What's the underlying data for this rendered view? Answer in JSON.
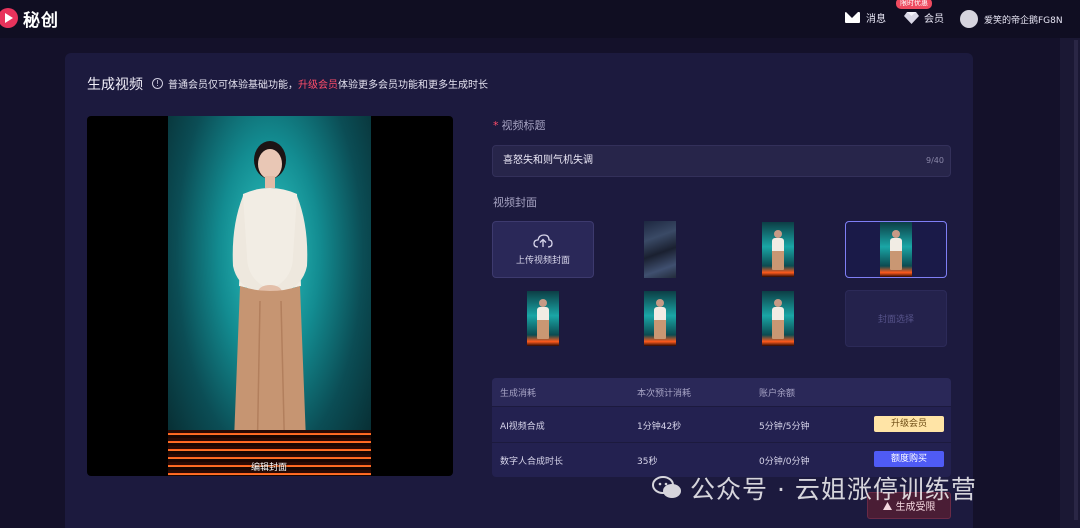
{
  "app": {
    "logo_text": "秘创"
  },
  "topbar": {
    "messages_label": "消息",
    "vip_label": "会员",
    "promo_badge": "限时优惠",
    "username": "爱笑的帝企鹅FG8N"
  },
  "page": {
    "title": "生成视频",
    "notice_prefix": "普通会员仅可体验基础功能，",
    "notice_highlight": "升级会员",
    "notice_suffix": "体验更多会员功能和更多生成时长"
  },
  "preview": {
    "edit_cover_label": "编辑封面"
  },
  "form": {
    "title_label": "视频标题",
    "title_value": "喜怒失和则气机失调",
    "title_count": "9/40",
    "cover_label": "视频封面",
    "upload_cover_label": "上传视频封面",
    "cover_select_label": "封面选择"
  },
  "cost_table": {
    "headers": [
      "生成消耗",
      "本次预计消耗",
      "账户余额"
    ],
    "rows": [
      {
        "item": "AI视频合成",
        "estimate": "1分钟42秒",
        "balance": "5分钟/5分钟",
        "action": "升级会员"
      },
      {
        "item": "数字人合成时长",
        "estimate": "35秒",
        "balance": "0分钟/0分钟",
        "action": "额度购买"
      }
    ]
  },
  "generate_button": "生成受限",
  "watermark": "公众号 · 云姐涨停训练营",
  "colors": {
    "accent_red": "#ff4d6a",
    "upgrade_pill": "#ffe4a6",
    "buy_pill": "#4f5bf5",
    "panel_bg": "#1c1a3e"
  }
}
